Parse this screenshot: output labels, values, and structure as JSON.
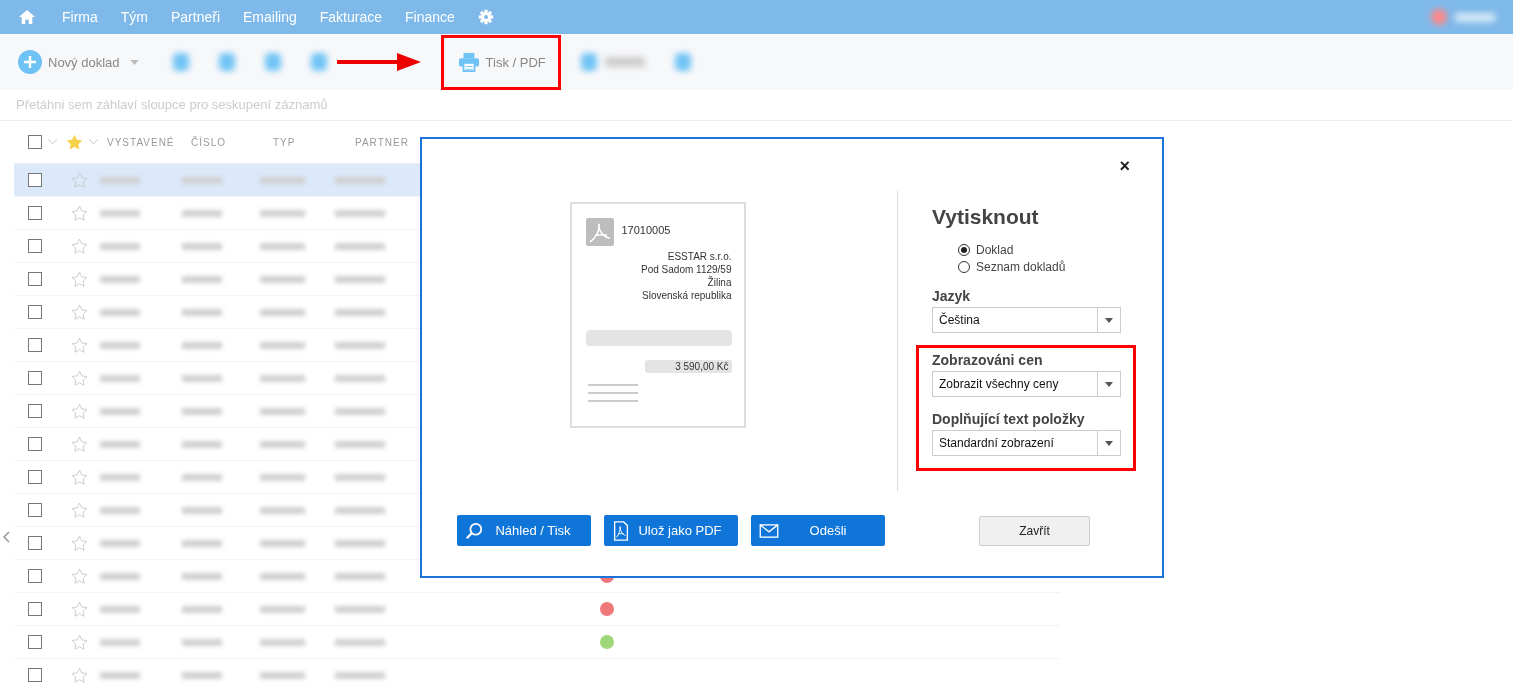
{
  "nav": {
    "items": [
      "Firma",
      "Tým",
      "Partneři",
      "Emailing",
      "Fakturace",
      "Finance"
    ]
  },
  "toolbar": {
    "new_button": "Nový doklad",
    "print_button": "Tisk / PDF",
    "print_highlighted": true
  },
  "group_hint": "Přetáhni sem záhlaví sloupce pro seskupení záznamů",
  "table": {
    "header_checked": false,
    "columns": [
      "VYSTAVENÉ",
      "ČÍSLO",
      "TYP",
      "PARTNER"
    ],
    "rows": [
      {
        "selected": true,
        "checked": false,
        "starred": false
      },
      {
        "selected": false,
        "checked": false,
        "starred": false
      },
      {
        "selected": false,
        "checked": false,
        "starred": false
      },
      {
        "selected": false,
        "checked": false,
        "starred": false
      },
      {
        "selected": false,
        "checked": false,
        "starred": false
      },
      {
        "selected": false,
        "checked": false,
        "starred": false
      },
      {
        "selected": false,
        "checked": false,
        "starred": false
      },
      {
        "selected": false,
        "checked": false,
        "starred": false
      },
      {
        "selected": false,
        "checked": false,
        "starred": false
      },
      {
        "selected": false,
        "checked": false,
        "starred": false
      },
      {
        "selected": false,
        "checked": false,
        "starred": false
      },
      {
        "selected": false,
        "checked": false,
        "starred": false
      },
      {
        "selected": false,
        "checked": false,
        "starred": false,
        "color": "#f0787a"
      },
      {
        "selected": false,
        "checked": false,
        "starred": false,
        "color": "#f0787a"
      },
      {
        "selected": false,
        "checked": false,
        "starred": false,
        "color": "#9fd67a"
      },
      {
        "selected": false,
        "checked": false,
        "starred": false
      }
    ]
  },
  "dialog": {
    "close": "×",
    "preview": {
      "number": "17010005",
      "address": [
        "ESSTAR s.r.o.",
        "Pod Sadom 1129/59",
        "Žilina",
        "Slovenská republika"
      ],
      "total": "3 590,00 Kč"
    },
    "title": "Vytisknout",
    "options": [
      {
        "label": "Doklad",
        "selected": true
      },
      {
        "label": "Seznam dokladů",
        "selected": false
      }
    ],
    "fields": [
      {
        "label": "Jazyk",
        "value": "Čeština",
        "highlighted": false
      },
      {
        "label": "Zobrazováni cen",
        "value": "Zobrazit všechny ceny",
        "highlighted": true
      },
      {
        "label": "Doplňující text položky",
        "value": "Standardní zobrazení",
        "highlighted": true
      }
    ],
    "actions": [
      {
        "kind": "preview",
        "label": "Náhled / Tisk"
      },
      {
        "kind": "pdf",
        "label": "Ulož jako PDF"
      },
      {
        "kind": "email",
        "label": "Odešli"
      }
    ],
    "close_button": "Zavřít"
  }
}
